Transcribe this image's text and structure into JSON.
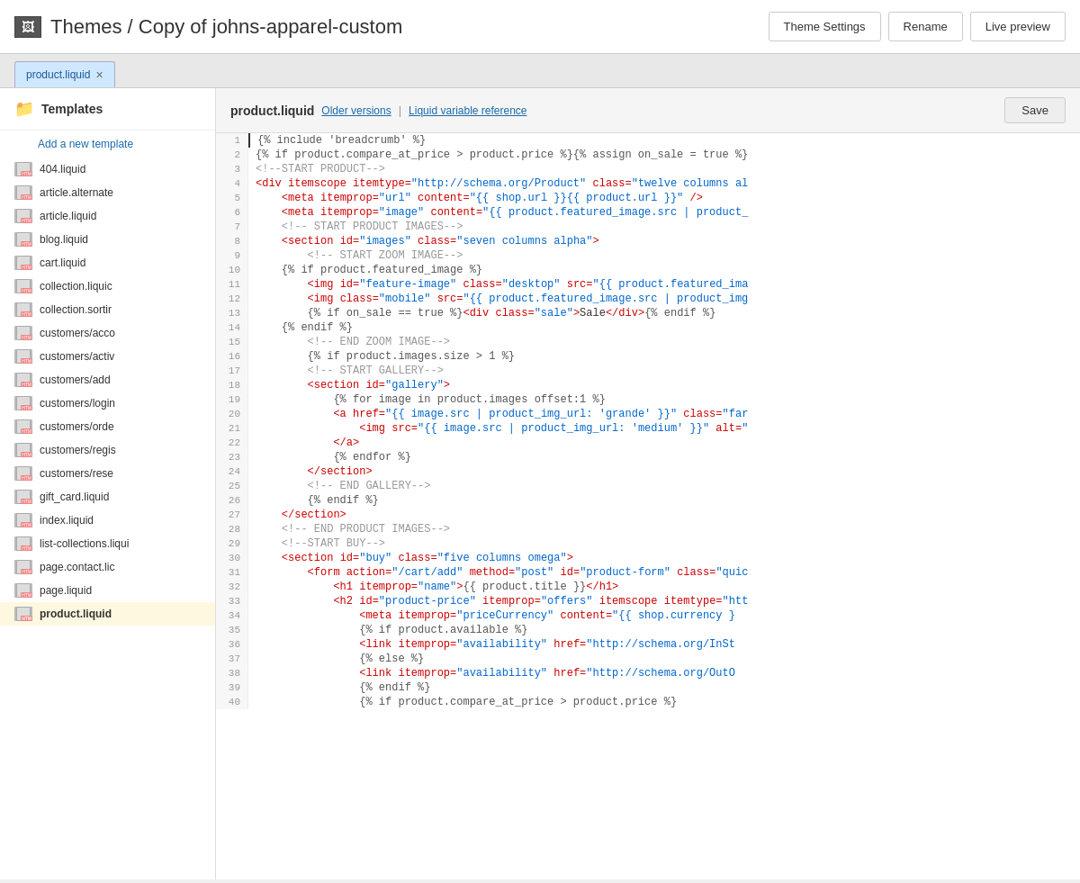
{
  "header": {
    "icon": "🖼",
    "breadcrumb": "Themes / Copy of johns-apparel-custom",
    "buttons": {
      "theme_settings": "Theme Settings",
      "rename": "Rename",
      "live_preview": "Live preview"
    }
  },
  "tab": {
    "label": "product.liquid",
    "close": "×"
  },
  "sidebar": {
    "title": "Templates",
    "add_label": "Add a new template",
    "items": [
      "404.liquid",
      "article.alternate",
      "article.liquid",
      "blog.liquid",
      "cart.liquid",
      "collection.liquic",
      "collection.sortir",
      "customers/acco",
      "customers/activ",
      "customers/add",
      "customers/login",
      "customers/orde",
      "customers/regis",
      "customers/rese",
      "gift_card.liquid",
      "index.liquid",
      "list-collections.liqui",
      "page.contact.lic",
      "page.liquid",
      "product.liquid"
    ]
  },
  "editor": {
    "filename": "product.liquid",
    "link1": "Older versions",
    "separator": "|",
    "link2": "Liquid variable reference",
    "save_label": "Save"
  },
  "code": {
    "lines": [
      {
        "num": 1,
        "text": "{% include 'breadcrumb' %}"
      },
      {
        "num": 2,
        "text": "{% if product.compare_at_price > product.price %}{% assign on_sale = true %}"
      },
      {
        "num": 3,
        "text": "<!--START PRODUCT-->"
      },
      {
        "num": 4,
        "text": "<div itemscope itemtype=\"http://schema.org/Product\" class=\"twelve columns al"
      },
      {
        "num": 5,
        "text": "    <meta itemprop=\"url\" content=\"{{ shop.url }}{{ product.url }}\" />"
      },
      {
        "num": 6,
        "text": "    <meta itemprop=\"image\" content=\"{{ product.featured_image.src | product_"
      },
      {
        "num": 7,
        "text": "    <!-- START PRODUCT IMAGES-->"
      },
      {
        "num": 8,
        "text": "    <section id=\"images\" class=\"seven columns alpha\">"
      },
      {
        "num": 9,
        "text": "        <!-- START ZOOM IMAGE-->"
      },
      {
        "num": 10,
        "text": "    {% if product.featured_image %}"
      },
      {
        "num": 11,
        "text": "        <img id=\"feature-image\" class=\"desktop\" src=\"{{ product.featured_ima"
      },
      {
        "num": 12,
        "text": "        <img class=\"mobile\" src=\"{{ product.featured_image.src | product_img"
      },
      {
        "num": 13,
        "text": "        {% if on_sale == true %}<div class=\"sale\">Sale</div>{% endif %}"
      },
      {
        "num": 14,
        "text": "    {% endif %}"
      },
      {
        "num": 15,
        "text": "        <!-- END ZOOM IMAGE-->"
      },
      {
        "num": 16,
        "text": "        {% if product.images.size > 1 %}"
      },
      {
        "num": 17,
        "text": "        <!-- START GALLERY-->"
      },
      {
        "num": 18,
        "text": "        <section id=\"gallery\">"
      },
      {
        "num": 19,
        "text": "            {% for image in product.images offset:1 %}"
      },
      {
        "num": 20,
        "text": "            <a href=\"{{ image.src | product_img_url: 'grande' }}\" class=\"far"
      },
      {
        "num": 21,
        "text": "                <img src=\"{{ image.src | product_img_url: 'medium' }}\" alt=\""
      },
      {
        "num": 22,
        "text": "            </a>"
      },
      {
        "num": 23,
        "text": "            {% endfor %}"
      },
      {
        "num": 24,
        "text": "        </section>"
      },
      {
        "num": 25,
        "text": "        <!-- END GALLERY-->"
      },
      {
        "num": 26,
        "text": "        {% endif %}"
      },
      {
        "num": 27,
        "text": "    </section>"
      },
      {
        "num": 28,
        "text": "    <!-- END PRODUCT IMAGES-->"
      },
      {
        "num": 29,
        "text": "    <!--START BUY-->"
      },
      {
        "num": 30,
        "text": "    <section id=\"buy\" class=\"five columns omega\">"
      },
      {
        "num": 31,
        "text": "        <form action=\"/cart/add\" method=\"post\" id=\"product-form\" class=\"quic"
      },
      {
        "num": 32,
        "text": "            <h1 itemprop=\"name\">{{ product.title }}</h1>"
      },
      {
        "num": 33,
        "text": "            <h2 id=\"product-price\" itemprop=\"offers\" itemscope itemtype=\"htt"
      },
      {
        "num": 34,
        "text": "                <meta itemprop=\"priceCurrency\" content=\"{{ shop.currency }"
      },
      {
        "num": 35,
        "text": "                {% if product.available %}"
      },
      {
        "num": 36,
        "text": "                <link itemprop=\"availability\" href=\"http://schema.org/InSt"
      },
      {
        "num": 37,
        "text": "                {% else %}"
      },
      {
        "num": 38,
        "text": "                <link itemprop=\"availability\" href=\"http://schema.org/OutO"
      },
      {
        "num": 39,
        "text": "                {% endif %}"
      },
      {
        "num": 40,
        "text": "                {% if product.compare_at_price > product.price %}"
      }
    ]
  }
}
